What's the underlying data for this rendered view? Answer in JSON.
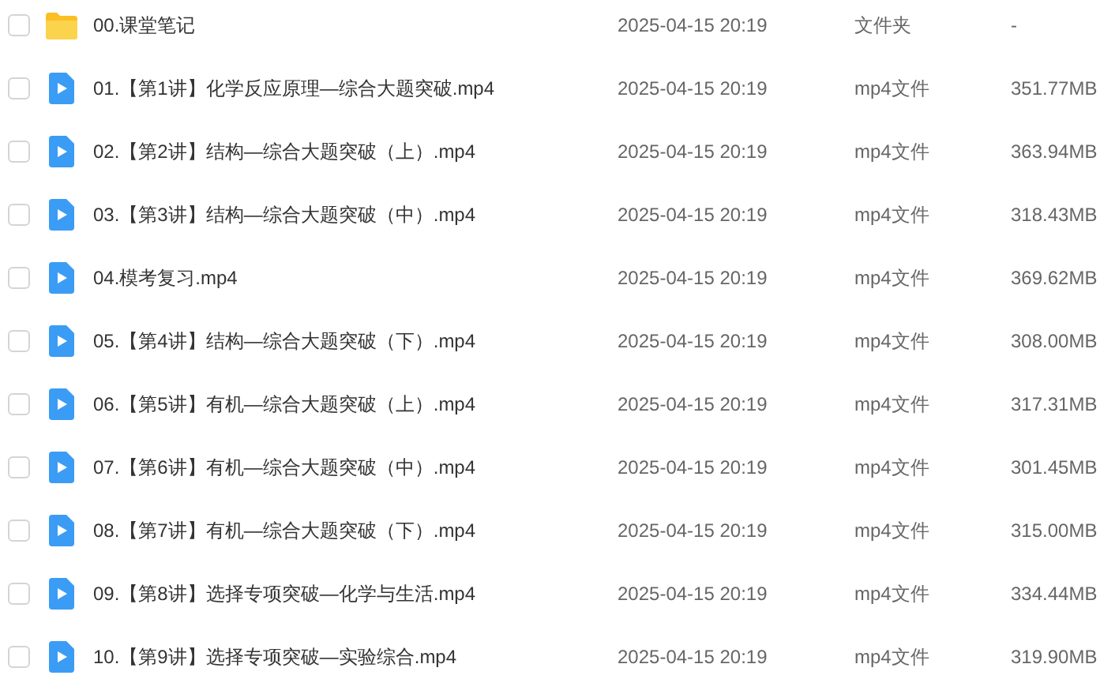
{
  "files": [
    {
      "kind": "folder",
      "checked": false,
      "name": "00.课堂笔记",
      "modified": "2025-04-15 20:19",
      "type": "文件夹",
      "size": "-"
    },
    {
      "kind": "video",
      "checked": false,
      "name": "01.【第1讲】化学反应原理—综合大题突破.mp4",
      "modified": "2025-04-15 20:19",
      "type": "mp4文件",
      "size": "351.77MB"
    },
    {
      "kind": "video",
      "checked": false,
      "name": "02.【第2讲】结构—综合大题突破（上）.mp4",
      "modified": "2025-04-15 20:19",
      "type": "mp4文件",
      "size": "363.94MB"
    },
    {
      "kind": "video",
      "checked": false,
      "name": "03.【第3讲】结构—综合大题突破（中）.mp4",
      "modified": "2025-04-15 20:19",
      "type": "mp4文件",
      "size": "318.43MB"
    },
    {
      "kind": "video",
      "checked": false,
      "name": "04.模考复习.mp4",
      "modified": "2025-04-15 20:19",
      "type": "mp4文件",
      "size": "369.62MB"
    },
    {
      "kind": "video",
      "checked": false,
      "name": "05.【第4讲】结构—综合大题突破（下）.mp4",
      "modified": "2025-04-15 20:19",
      "type": "mp4文件",
      "size": "308.00MB"
    },
    {
      "kind": "video",
      "checked": false,
      "name": "06.【第5讲】有机—综合大题突破（上）.mp4",
      "modified": "2025-04-15 20:19",
      "type": "mp4文件",
      "size": "317.31MB"
    },
    {
      "kind": "video",
      "checked": false,
      "name": "07.【第6讲】有机—综合大题突破（中）.mp4",
      "modified": "2025-04-15 20:19",
      "type": "mp4文件",
      "size": "301.45MB"
    },
    {
      "kind": "video",
      "checked": false,
      "name": "08.【第7讲】有机—综合大题突破（下）.mp4",
      "modified": "2025-04-15 20:19",
      "type": "mp4文件",
      "size": "315.00MB"
    },
    {
      "kind": "video",
      "checked": false,
      "name": "09.【第8讲】选择专项突破—化学与生活.mp4",
      "modified": "2025-04-15 20:19",
      "type": "mp4文件",
      "size": "334.44MB"
    },
    {
      "kind": "video",
      "checked": false,
      "name": "10.【第9讲】选择专项突破—实验综合.mp4",
      "modified": "2025-04-15 20:19",
      "type": "mp4文件",
      "size": "319.90MB"
    }
  ]
}
